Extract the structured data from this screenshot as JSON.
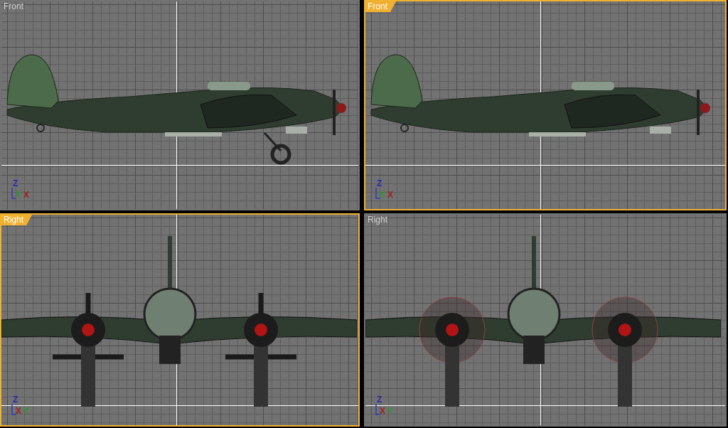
{
  "viewports": [
    {
      "label": "Front",
      "selected": false,
      "kind": "side",
      "gear_down": true,
      "axes": [
        "Z",
        "Y",
        "X"
      ]
    },
    {
      "label": "Front",
      "selected": true,
      "kind": "side",
      "gear_down": false,
      "axes": [
        "Z",
        "Y",
        "X"
      ]
    },
    {
      "label": "Right",
      "selected": true,
      "kind": "front",
      "props_spinning": false,
      "axes": [
        "Z",
        "X",
        "Y"
      ]
    },
    {
      "label": "Right",
      "selected": false,
      "kind": "front",
      "props_spinning": true,
      "axes": [
        "Z",
        "X",
        "Y"
      ]
    }
  ]
}
